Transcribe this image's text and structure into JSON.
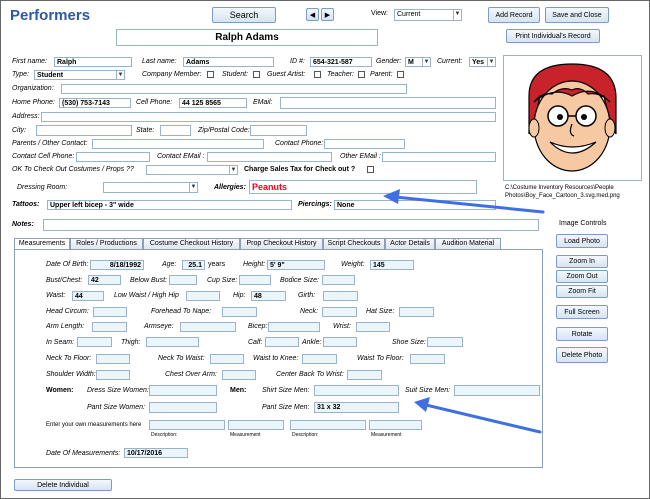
{
  "header": {
    "title": "Performers",
    "search_label": "Search",
    "prev_icon": "triangle-left",
    "next_icon": "triangle-right",
    "view_label": "View:",
    "view_value": "Current",
    "add_record_label": "Add Record",
    "save_close_label": "Save and Close",
    "print_label": "Print Individual's Record",
    "full_name": "Ralph Adams"
  },
  "person": {
    "first_name_label": "First name:",
    "first_name": "Ralph",
    "last_name_label": "Last name:",
    "last_name": "Adams",
    "id_label": "ID #:",
    "id": "654-321-587",
    "gender_label": "Gender:",
    "gender": "M",
    "current_label": "Current:",
    "current": "Yes",
    "type_label": "Type:",
    "type": "Student",
    "company_member_label": "Company Member:",
    "student_label": "Student:",
    "guest_artist_label": "Guest Artist:",
    "teacher_label": "Teacher:",
    "parent_label": "Parent:",
    "organization_label": "Organization:",
    "home_phone_label": "Home Phone:",
    "home_phone": "(530) 753-7143",
    "cell_phone_label": "Cell Phone:",
    "cell_phone": "44 125 8565",
    "email_label": "EMail:",
    "address_label": "Address:",
    "city_label": "City:",
    "state_label": "State:",
    "zip_label": "Zip/Postal Code:",
    "parents_contact_label": "Parents / Other Contact:",
    "contact_phone_label": "Contact Phone:",
    "contact_cell_label": "Contact Cell Phone:",
    "contact_email_label": "Contact EMail :",
    "other_email_label": "Other EMail :",
    "ok_checkout_label": "OK To Check Out Costumes / Props ??",
    "sales_tax_label": "Charge Sales Tax for Check out ?",
    "dressing_room_label": "Dressing Room:",
    "allergies_label": "Allergies:",
    "allergies": "Peanuts",
    "tattoos_label": "Tattoos:",
    "tattoos": "Upper left bicep - 3\" wide",
    "piercings_label": "Piercings:",
    "piercings": "None",
    "notes_label": "Notes:"
  },
  "photo": {
    "path": "C:\\Costume Inventory Resources\\People Photos\\Boy_Face_Cartoon_3.svg.med.png",
    "controls_label": "Image Controls",
    "load_label": "Load Photo",
    "zoom_in_label": "Zoom In",
    "zoom_out_label": "Zoom Out",
    "zoom_fit_label": "Zoom Fit",
    "full_screen_label": "Full Screen",
    "rotate_label": "Rotate",
    "delete_label": "Delete Photo"
  },
  "tabs": [
    "Measurements",
    "Roles / Productions",
    "Costume Checkout History",
    "Prop Checkout History",
    "Script Checkouts",
    "Actor Details",
    "Audition Material"
  ],
  "measure": {
    "dob_label": "Date Of Birth:",
    "dob": "8/18/1992",
    "age_label": "Age:",
    "age": "25.1",
    "years_label": "years",
    "height_label": "Height:",
    "height": "5' 9\"",
    "weight_label": "Weight:",
    "weight": "145",
    "bust_label": "Bust/Chest:",
    "bust": "42",
    "below_bust_label": "Below Bust:",
    "cup_label": "Cup Size:",
    "bodice_label": "Bodice Size:",
    "waist_label": "Waist:",
    "waist": "44",
    "low_waist_label": "Low Waist / High Hip",
    "hip_label": "Hip:",
    "hip": "48",
    "girth_label": "Girth:",
    "head_label": "Head Circum:",
    "forehead_label": "Forehead To Nape:",
    "neck_label": "Neck:",
    "hat_label": "Hat Size:",
    "arm_label": "Arm Length:",
    "armseye_label": "Armseye:",
    "bicep_label": "Bicep:",
    "wrist_label": "Wrist:",
    "inseam_label": "In Seam:",
    "thigh_label": "Thigh:",
    "calf_label": "Calf:",
    "ankle_label": "Ankle:",
    "shoe_label": "Shoe Size:",
    "neck_floor_label": "Neck To Floor:",
    "neck_waist_label": "Neck To Waist:",
    "waist_knee_label": "Waist to Knee:",
    "waist_floor_label": "Waist To Floor:",
    "shoulder_label": "Shoulder Width:",
    "chest_arm_label": "Chest Over Arm:",
    "center_back_label": "Center Back To Wrist:",
    "women_label": "Women:",
    "dress_label": "Dress Size Women:",
    "pant_women_label": "Pant Size Women:",
    "men_label": "Men:",
    "shirt_label": "Shirt Size Men:",
    "suit_label": "Suit Size Men:",
    "pant_men_label": "Pant Size Men:",
    "pant_men": "31 x 32",
    "own_label": "Enter your own measurements here",
    "description_label": "Description:",
    "measurement_label": "Measurement",
    "date_label": "Date Of Measurements:",
    "date": "10/17/2016"
  },
  "footer": {
    "delete_label": "Delete Individual"
  },
  "colors": {
    "title_blue": "#2c5aa0",
    "allergy_red": "#e8002a",
    "arrow_blue": "#3f6fe0",
    "hair": "#c8222a"
  }
}
